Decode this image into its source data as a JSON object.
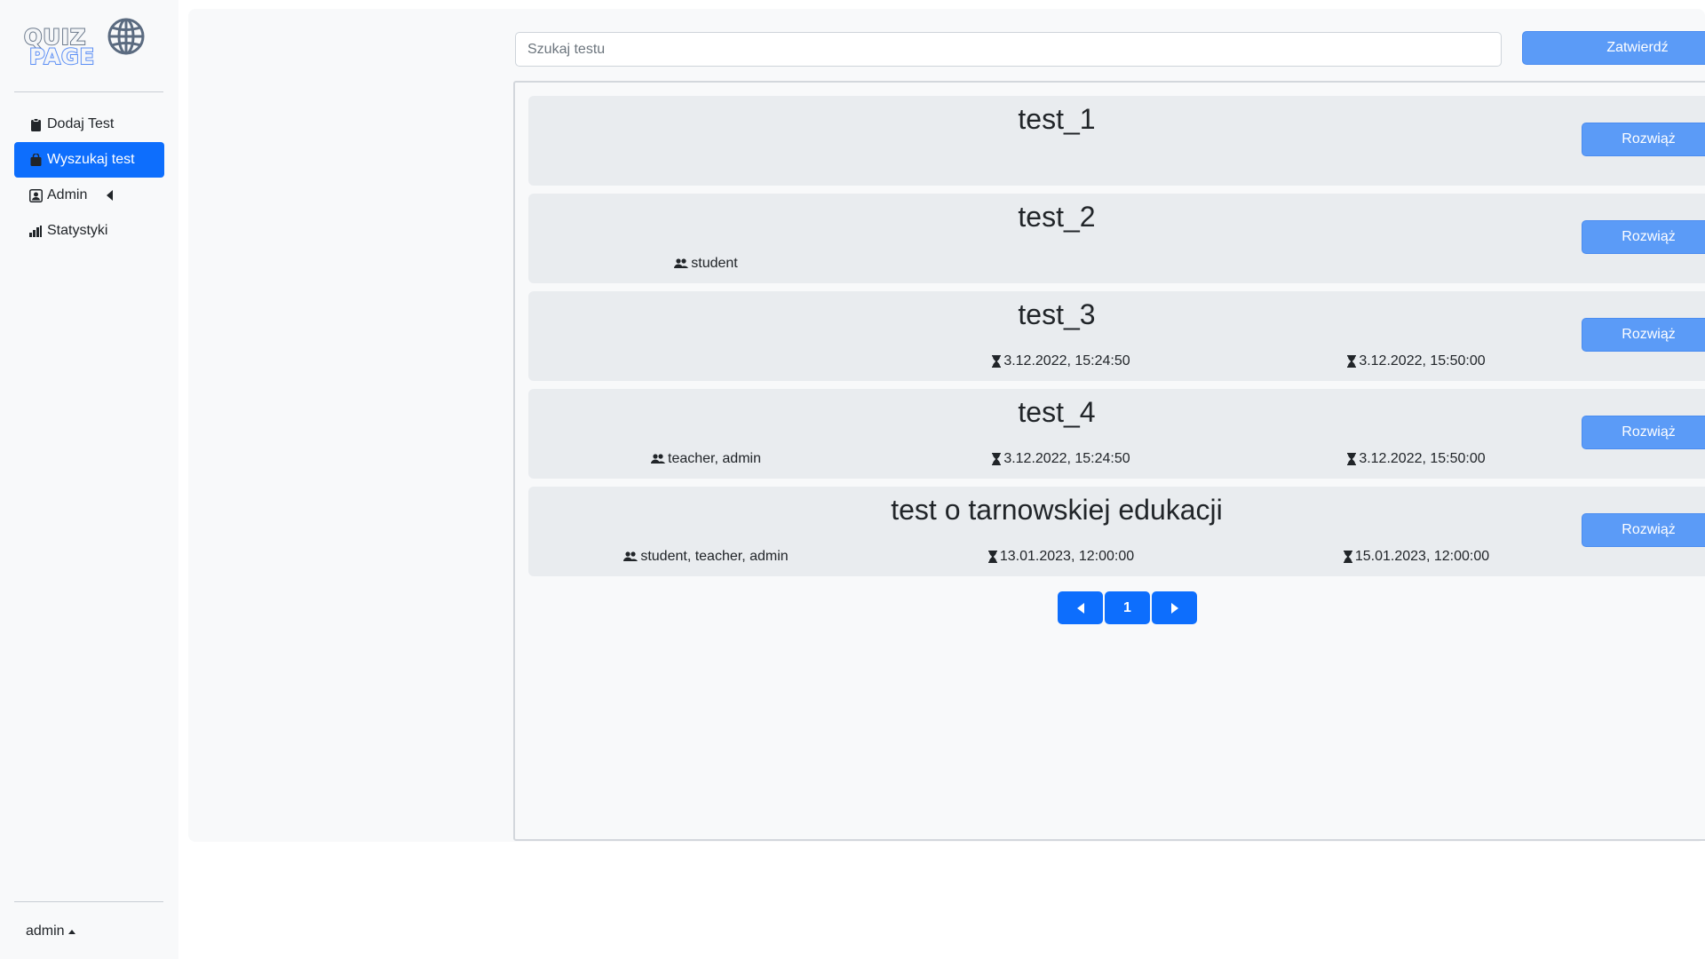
{
  "logo": {
    "line1": "QUIZ",
    "line2": "PAGE",
    "icon": "globe-icon"
  },
  "sidebar": {
    "items": [
      {
        "label": "Dodaj Test",
        "icon": "clipboard-icon",
        "active": false
      },
      {
        "label": "Wyszukaj test",
        "icon": "bag-icon",
        "active": true
      },
      {
        "label": "Admin",
        "icon": "person-badge-icon",
        "active": false
      },
      {
        "label": "Statystyki",
        "icon": "bar-chart-icon",
        "active": false
      }
    ],
    "user": "admin"
  },
  "search": {
    "placeholder": "Szukaj testu",
    "value": "",
    "submit_label": "Zatwierdź"
  },
  "tests": [
    {
      "title": "test_1",
      "users": "",
      "start": "",
      "end": "",
      "solve_label": "Rozwiąż"
    },
    {
      "title": "test_2",
      "users": "student",
      "start": "",
      "end": "",
      "solve_label": "Rozwiąż"
    },
    {
      "title": "test_3",
      "users": "",
      "start": "3.12.2022, 15:24:50",
      "end": "3.12.2022, 15:50:00",
      "solve_label": "Rozwiąż"
    },
    {
      "title": "test_4",
      "users": "teacher, admin",
      "start": "3.12.2022, 15:24:50",
      "end": "3.12.2022, 15:50:00",
      "solve_label": "Rozwiąż"
    },
    {
      "title": "test o tarnowskiej edukacji",
      "users": "student, teacher, admin",
      "start": "13.01.2023, 12:00:00",
      "end": "15.01.2023, 12:00:00",
      "solve_label": "Rozwiąż"
    }
  ],
  "pagination": {
    "current_page": "1"
  },
  "colors": {
    "primary": "#0d6efd",
    "button_light": "#5b9bf7",
    "card_bg": "#e9ecef",
    "panel_bg": "#f8f9fa"
  }
}
